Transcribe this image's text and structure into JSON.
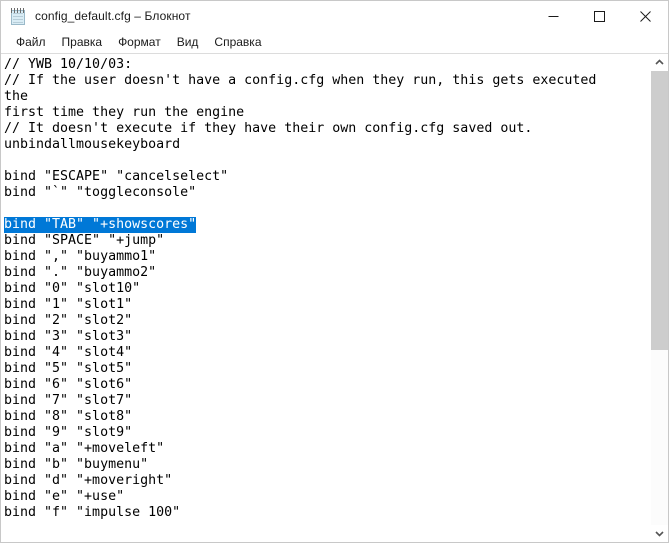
{
  "window": {
    "title": "config_default.cfg – Блокнот",
    "icon": "notepad-icon",
    "controls": {
      "minimize": "minimize-icon",
      "maximize": "maximize-icon",
      "close": "close-icon"
    }
  },
  "menu": {
    "items": [
      {
        "label": "Файл"
      },
      {
        "label": "Правка"
      },
      {
        "label": "Формат"
      },
      {
        "label": "Вид"
      },
      {
        "label": "Справка"
      }
    ]
  },
  "editor": {
    "selected_line_index": 9,
    "selection_color": "#0078d7",
    "selection_text_color": "#ffffff",
    "lines": [
      "// YWB 10/10/03:",
      "// If the user doesn't have a config.cfg when they run, this gets executed the",
      "first time they run the engine",
      "// It doesn't execute if they have their own config.cfg saved out.",
      "unbindallmousekeyboard",
      "",
      "bind \"ESCAPE\" \"cancelselect\"",
      "bind \"`\" \"toggleconsole\"",
      "",
      "bind \"TAB\" \"+showscores\"",
      "bind \"SPACE\" \"+jump\"",
      "bind \",\" \"buyammo1\"",
      "bind \".\" \"buyammo2\"",
      "bind \"0\" \"slot10\"",
      "bind \"1\" \"slot1\"",
      "bind \"2\" \"slot2\"",
      "bind \"3\" \"slot3\"",
      "bind \"4\" \"slot4\"",
      "bind \"5\" \"slot5\"",
      "bind \"6\" \"slot6\"",
      "bind \"7\" \"slot7\"",
      "bind \"8\" \"slot8\"",
      "bind \"9\" \"slot9\"",
      "bind \"a\" \"+moveleft\"",
      "bind \"b\" \"buymenu\"",
      "bind \"d\" \"+moveright\"",
      "bind \"e\" \"+use\"",
      "bind \"f\" \"impulse 100\""
    ]
  },
  "scrollbar": {
    "up_arrow": "chevron-up-icon",
    "down_arrow": "chevron-down-icon",
    "thumb_top_percent": 0,
    "thumb_height_percent": 61.5
  }
}
